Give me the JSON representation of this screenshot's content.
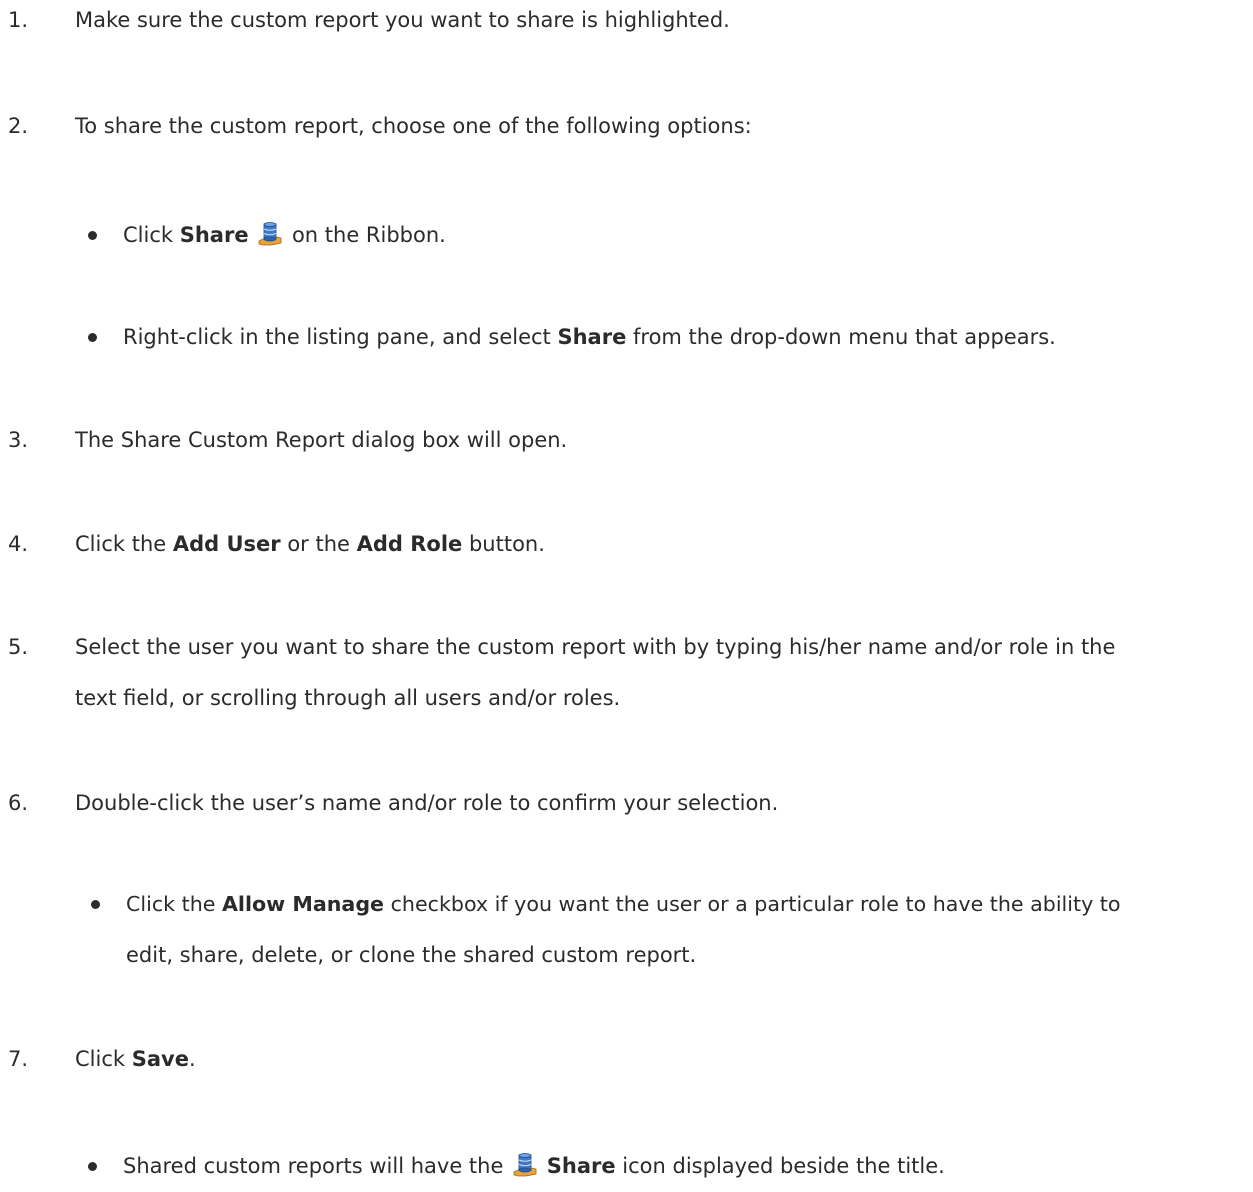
{
  "steps": [
    {
      "number": "1.",
      "text": "Make sure the custom report you want to share is highlighted."
    },
    {
      "number": "2.",
      "text": "To share the custom report, choose one of the following options:"
    },
    {
      "number": "3.",
      "text": "The Share Custom Report dialog box will open."
    },
    {
      "number": "4.",
      "parts": [
        "Click the ",
        "Add User",
        " or the ",
        "Add Role",
        " button."
      ]
    },
    {
      "number": "5.",
      "line1": "Select the user you want to share the custom report with by typing his/her name and/or role in the",
      "line2": "text field, or scrolling through all users and/or roles."
    },
    {
      "number": "6.",
      "text": "Double-click the user’s name and/or role to confirm your selection."
    },
    {
      "number": "7.",
      "parts": [
        "Click ",
        "Save",
        "."
      ]
    }
  ],
  "step2_bullets": [
    {
      "parts": [
        "Click ",
        "Share",
        "",
        " on the Ribbon."
      ]
    },
    {
      "parts": [
        "Right-click in the listing pane, and select ",
        "Share",
        " from the drop-down menu that appears."
      ]
    }
  ],
  "step6_bullet": {
    "parts": [
      "Click the ",
      "Allow Manage",
      " checkbox if you want the user or a particular role to have the ability to"
    ],
    "line2": "edit, share, delete, or clone the shared custom report."
  },
  "step7_bullet": {
    "parts": [
      "Shared custom reports will have the ",
      "",
      " ",
      "Share",
      " icon displayed beside the title."
    ]
  },
  "icons": {
    "share": "share-database-icon"
  },
  "colors": {
    "text": "#2b2b2b",
    "background": "#ffffff"
  }
}
